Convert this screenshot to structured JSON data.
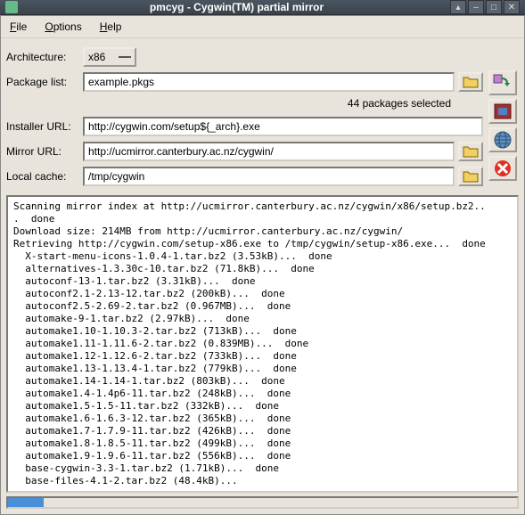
{
  "window": {
    "title": "pmcyg - Cygwin(TM) partial mirror"
  },
  "menu": {
    "file": "File",
    "options": "Options",
    "help": "Help"
  },
  "form": {
    "architecture": {
      "label": "Architecture:",
      "value": "x86"
    },
    "package_list": {
      "label": "Package list:",
      "value": "example.pkgs"
    },
    "pkg_status": "44 packages selected",
    "installer_url": {
      "label": "Installer URL:",
      "value": "http://cygwin.com/setup${_arch}.exe"
    },
    "mirror_url": {
      "label": "Mirror URL:",
      "value": "http://ucmirror.canterbury.ac.nz/cygwin/"
    },
    "local_cache": {
      "label": "Local cache:",
      "value": "/tmp/cygwin"
    }
  },
  "icons": {
    "folder": "folder-icon",
    "build": "build-icon",
    "stats": "stats-icon",
    "download": "download-icon",
    "cancel": "cancel-icon"
  },
  "output_lines": [
    "Scanning mirror index at http://ucmirror.canterbury.ac.nz/cygwin/x86/setup.bz2..",
    ".  done",
    "Download size: 214MB from http://ucmirror.canterbury.ac.nz/cygwin/",
    "Retrieving http://cygwin.com/setup-x86.exe to /tmp/cygwin/setup-x86.exe...  done",
    "  X-start-menu-icons-1.0.4-1.tar.bz2 (3.53kB)...  done",
    "  alternatives-1.3.30c-10.tar.bz2 (71.8kB)...  done",
    "  autoconf-13-1.tar.bz2 (3.31kB)...  done",
    "  autoconf2.1-2.13-12.tar.bz2 (200kB)...  done",
    "  autoconf2.5-2.69-2.tar.bz2 (0.967MB)...  done",
    "  automake-9-1.tar.bz2 (2.97kB)...  done",
    "  automake1.10-1.10.3-2.tar.bz2 (713kB)...  done",
    "  automake1.11-1.11.6-2.tar.bz2 (0.839MB)...  done",
    "  automake1.12-1.12.6-2.tar.bz2 (733kB)...  done",
    "  automake1.13-1.13.4-1.tar.bz2 (779kB)...  done",
    "  automake1.14-1.14-1.tar.bz2 (803kB)...  done",
    "  automake1.4-1.4p6-11.tar.bz2 (248kB)...  done",
    "  automake1.5-1.5-11.tar.bz2 (332kB)...  done",
    "  automake1.6-1.6.3-12.tar.bz2 (365kB)...  done",
    "  automake1.7-1.7.9-11.tar.bz2 (426kB)...  done",
    "  automake1.8-1.8.5-11.tar.bz2 (499kB)...  done",
    "  automake1.9-1.9.6-11.tar.bz2 (556kB)...  done",
    "  base-cygwin-3.3-1.tar.bz2 (1.71kB)...  done",
    "  base-files-4.1-2.tar.bz2 (48.4kB)..."
  ],
  "progress": {
    "percent": 7
  }
}
